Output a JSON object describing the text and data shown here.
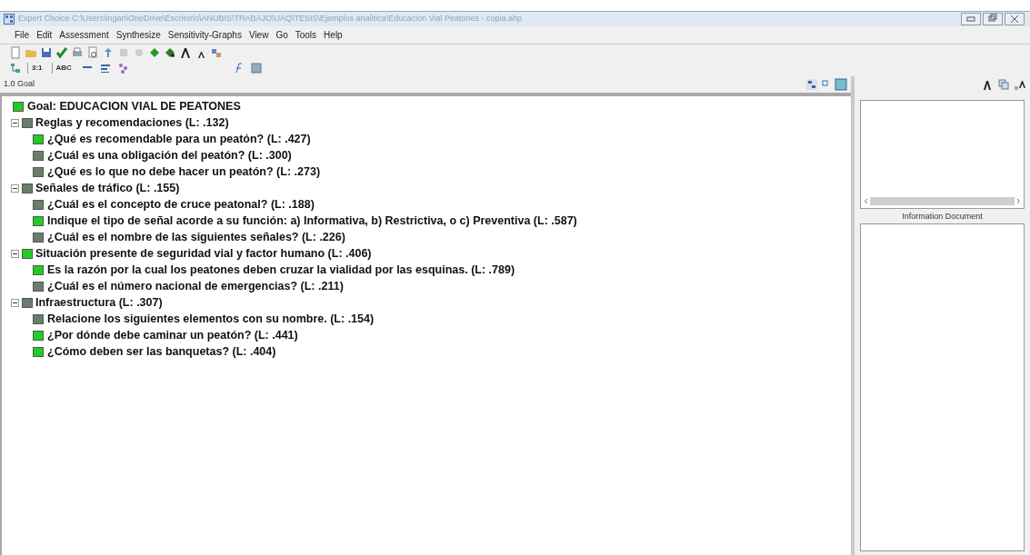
{
  "window": {
    "title": "Expert Choice    C:\\Users\\ingan\\OneDrive\\Escritorio\\ANUBIS\\TRABAJO\\UAQ\\TESIS\\Ejemplos analitica\\Educacion Vial Peatones - copia.ahp"
  },
  "menu": [
    "File",
    "Edit",
    "Assessment",
    "Synthesize",
    "Sensitivity-Graphs",
    "View",
    "Go",
    "Tools",
    "Help"
  ],
  "toolbar2": [
    "3:1",
    "ABC"
  ],
  "node_bar": {
    "label": "1.0 Goal"
  },
  "tree": {
    "label": "Goal: EDUCACION VIAL DE PEATONES",
    "color": "#22cc22",
    "children": [
      {
        "label": "Reglas y recomendaciones (L: .132)",
        "color": "#6b7d6b",
        "expanded": true,
        "children": [
          {
            "label": "¿Qué es recomendable para un peatón? (L: .427)",
            "color": "#22cc22"
          },
          {
            "label": "¿Cuál es una obligación del peatón? (L: .300)",
            "color": "#6b7d6b"
          },
          {
            "label": "¿Qué es lo que no debe hacer un peatón? (L: .273)",
            "color": "#6b7d6b"
          }
        ]
      },
      {
        "label": "Señales de tráfico (L: .155)",
        "color": "#6b7d6b",
        "expanded": true,
        "children": [
          {
            "label": "¿Cuál es el concepto de cruce peatonal? (L: .188)",
            "color": "#6b7d6b"
          },
          {
            "label": "Indique el tipo de señal acorde a su función: a) Informativa, b) Restrictiva, o c) Preventiva (L: .587)",
            "color": "#22cc22"
          },
          {
            "label": "¿Cuál es el nombre de las siguientes señales? (L: .226)",
            "color": "#6b7d6b"
          }
        ]
      },
      {
        "label": "Situación presente de seguridad vial y factor humano (L: .406)",
        "color": "#22cc22",
        "expanded": true,
        "children": [
          {
            "label": "Es la razón por la cual los peatones deben cruzar la vialidad por las esquinas. (L: .789)",
            "color": "#22cc22"
          },
          {
            "label": "¿Cuál es el número nacional de emergencias? (L: .211)",
            "color": "#6b7d6b"
          }
        ]
      },
      {
        "label": "Infraestructura (L: .307)",
        "color": "#6b7d6b",
        "expanded": true,
        "children": [
          {
            "label": "Relacione los siguientes elementos con su nombre. (L: .154)",
            "color": "#6b7d6b"
          },
          {
            "label": "¿Por dónde debe caminar un peatón? (L: .441)",
            "color": "#22cc22"
          },
          {
            "label": "¿Cómo deben ser las banquetas? (L: .404)",
            "color": "#22cc22"
          }
        ]
      }
    ]
  },
  "info_panel": {
    "label": "Information Document"
  }
}
